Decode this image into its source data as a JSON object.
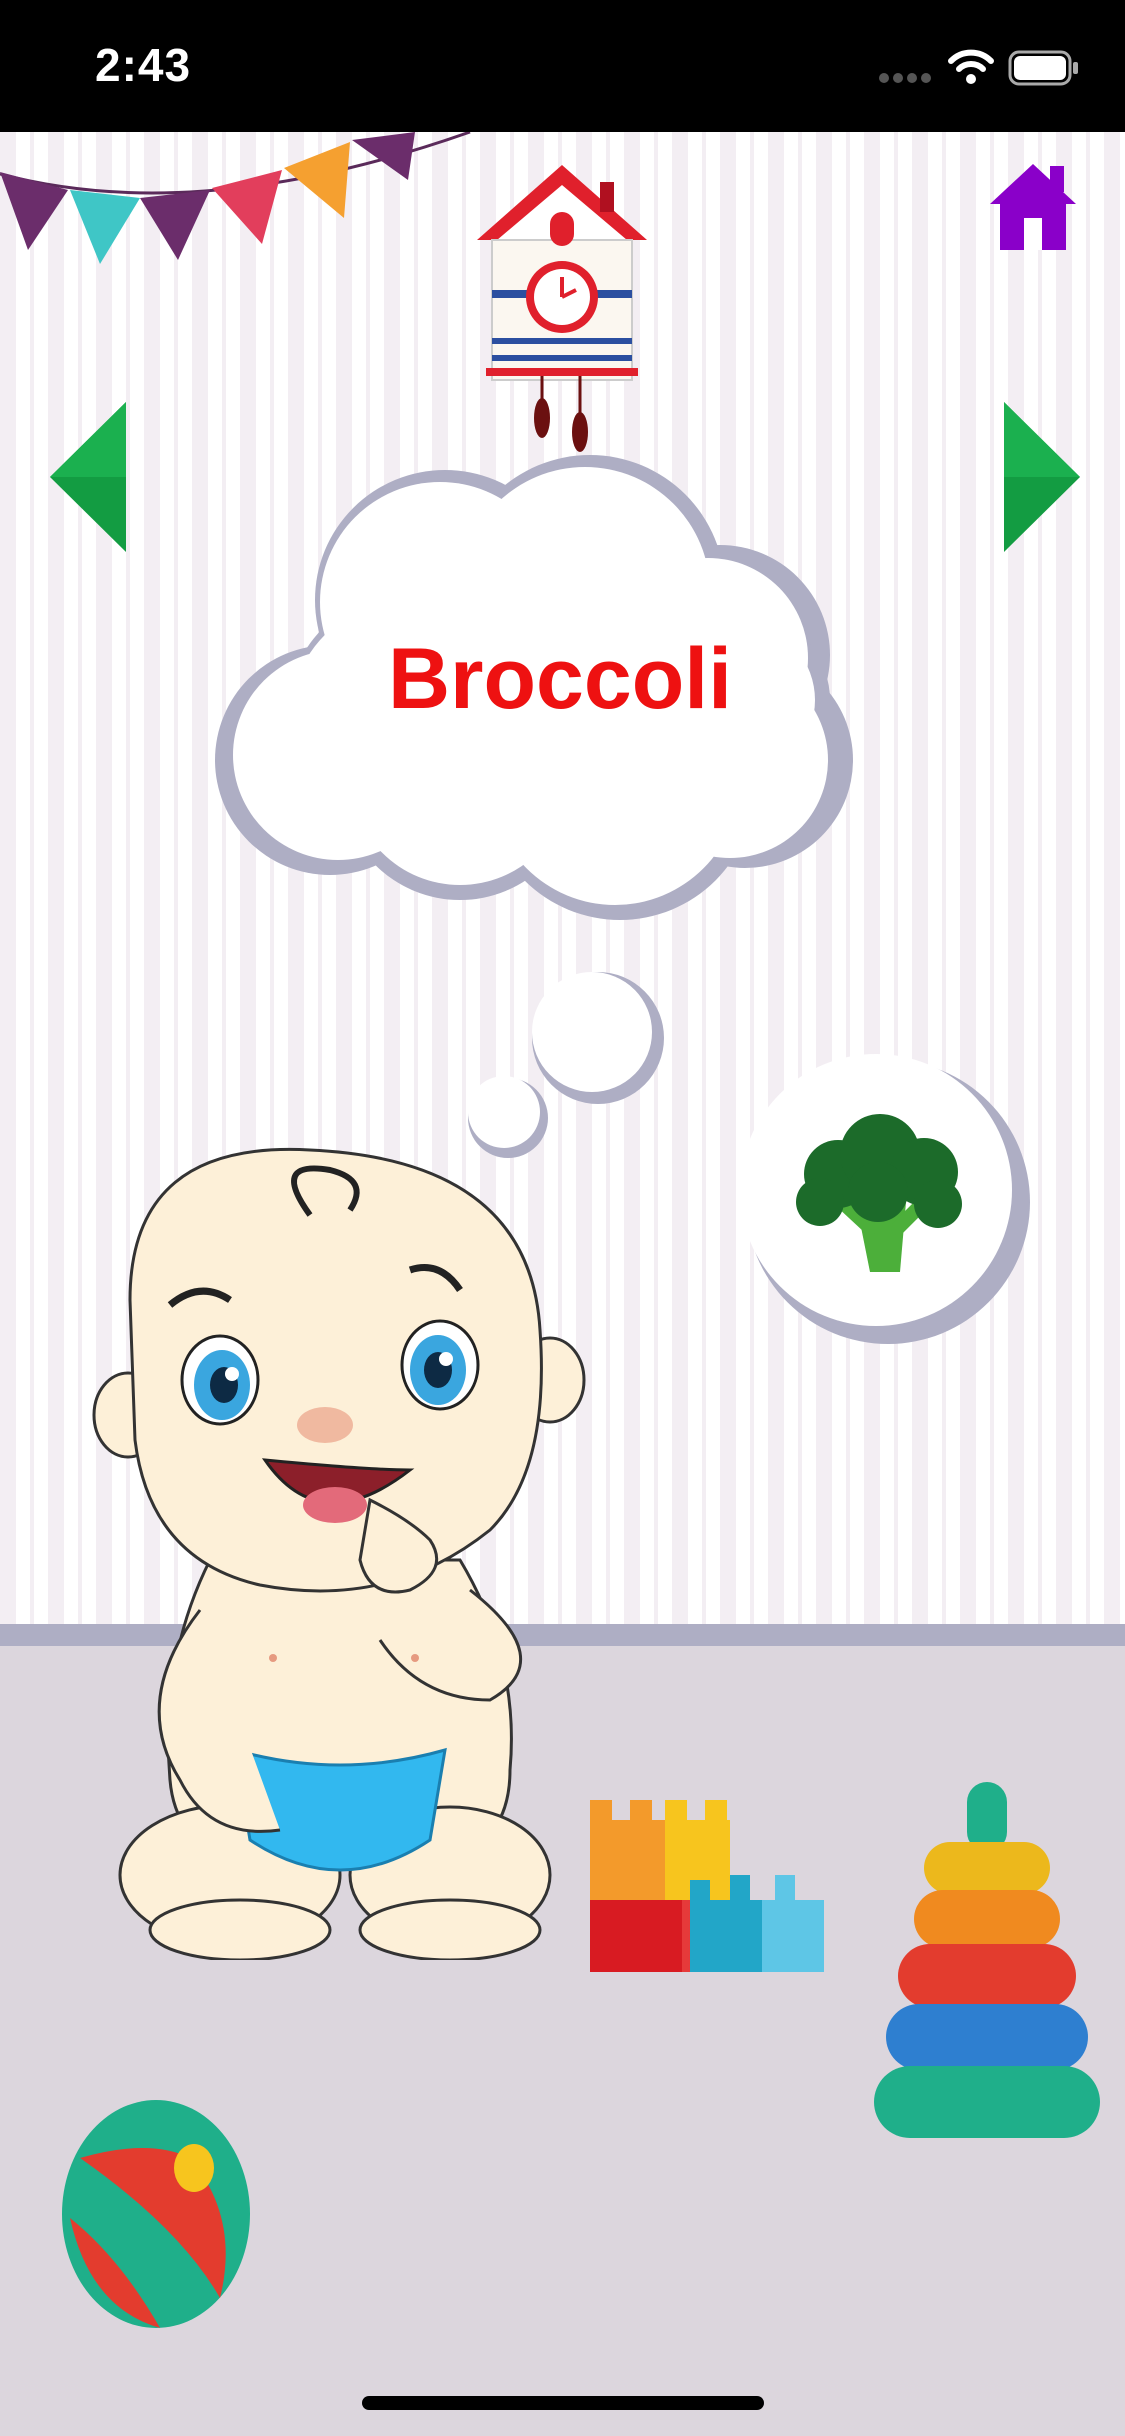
{
  "status_bar": {
    "time": "2:43",
    "icons": [
      "cellular-icon",
      "wifi-icon",
      "battery-icon"
    ]
  },
  "navigation": {
    "home_icon": "home-icon",
    "previous_icon": "arrow-left-icon",
    "next_icon": "arrow-right-icon"
  },
  "card": {
    "word": "Broccoli",
    "picture_icon": "broccoli-icon"
  },
  "colors": {
    "word_text": "#ee1111",
    "home_button": "#8a00c9",
    "arrow_buttons": "#139c42"
  }
}
